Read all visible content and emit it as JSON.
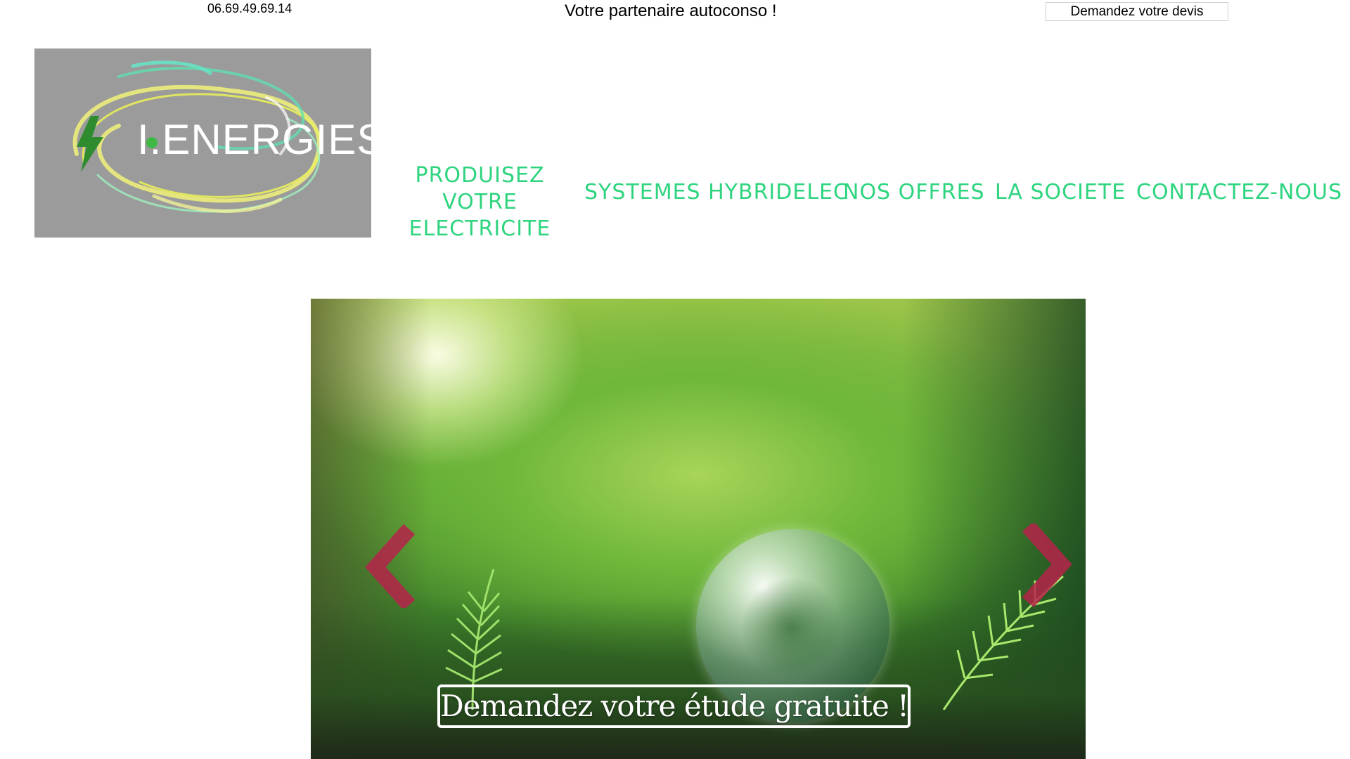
{
  "topbar": {
    "phone": "06.69.49.69.14",
    "tagline": "Votre partenaire autoconso !",
    "devis_button": "Demandez votre devis"
  },
  "logo": {
    "text": "I.ENERGIES",
    "icon": "lightning-bolt-icon",
    "background_color": "#9b9b9b"
  },
  "nav": {
    "color": "#2fd47f",
    "items": [
      {
        "label": "PRODUISEZ VOTRE ELECTRICITE"
      },
      {
        "label": "SYSTEMES HYBRIDELEC"
      },
      {
        "label": "NOS OFFRES"
      },
      {
        "label": "LA SOCIETE"
      },
      {
        "label": "CONTACTEZ-NOUS"
      }
    ]
  },
  "hero": {
    "cta_label": "Demandez votre étude gratuite !",
    "prev_icon": "chevron-left-icon",
    "next_icon": "chevron-right-icon",
    "arrow_color": "#b5234a"
  }
}
